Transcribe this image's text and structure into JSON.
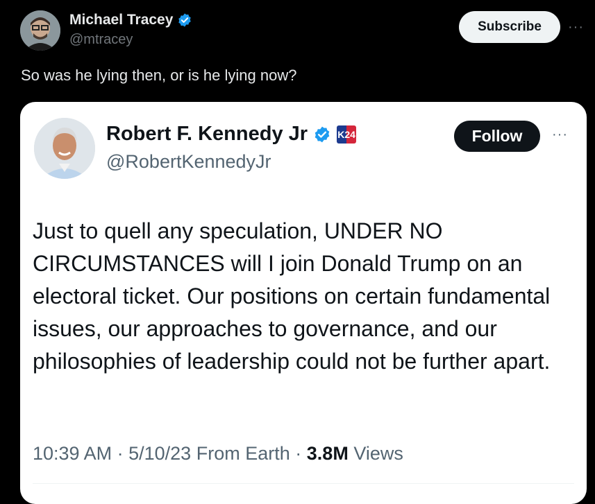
{
  "post": {
    "author_name": "Michael Tracey",
    "author_handle": "@mtracey",
    "subscribe_label": "Subscribe",
    "more_label": "···",
    "text": "So was he lying then, or is he lying now?"
  },
  "quoted": {
    "author_name": "Robert F. Kennedy Jr",
    "author_handle": "@RobertKennedyJr",
    "badge_label": "K24",
    "follow_label": "Follow",
    "more_label": "···",
    "body": "Just to quell any speculation, UNDER NO CIRCUMSTANCES will I join Donald Trump on an electoral ticket. Our positions on certain fundamental issues, our approaches to governance, and our philosophies of leadership could not be further apart.",
    "time": "10:39 AM",
    "sep1": "·",
    "date": "5/10/23",
    "location": "From Earth",
    "sep2": "·",
    "views_count": "3.8M",
    "views_label": "Views"
  },
  "colors": {
    "background": "#000000",
    "verified_blue": "#1d9bf0",
    "card_background": "#ffffff"
  },
  "icons": [
    "verified-badge-icon",
    "k24-badge-icon",
    "more-icon"
  ]
}
